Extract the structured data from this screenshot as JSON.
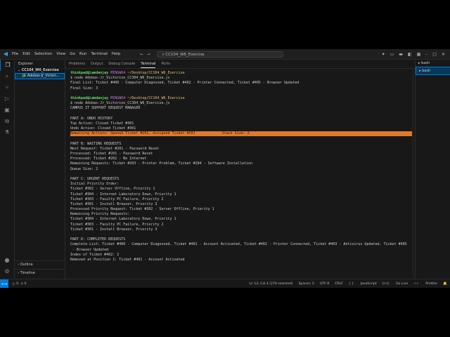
{
  "window": {
    "menu": [
      "File",
      "Edit",
      "Selection",
      "View",
      "Go",
      "Run",
      "Terminal",
      "Help"
    ],
    "search": "CC104_W6_Exercise"
  },
  "sidebar": {
    "title": "Explorer",
    "folder": "CC104_W6_Exercise",
    "file": "Adobas-Jr_Victori...",
    "outline": "Outline",
    "timeline": "Timeline"
  },
  "panel_tabs": [
    "Problems",
    "Output",
    "Debug Console",
    "Terminal",
    "Ports"
  ],
  "active_tab": "Terminal",
  "sessions": [
    "bash",
    "bash"
  ],
  "terminal": {
    "prompt_user": "thinkpad@Lamdanjay",
    "prompt_host": "MINGW64",
    "prompt_path": "~/Desktop/CC104_W6_Exercise",
    "command": "$ node Adobas-Jr_Victorino_CC304_W6_Exercise.js",
    "lines_first": [
      "Final List: Ticket #400 - Computer Diagnosed, Ticket #402 - Printer Connected, Ticket #405 - Browser Updated",
      "Final Size: 3"
    ],
    "lines_main": [
      "CAMPUS IT SUPPORT REQUEST MANAGER",
      "",
      "PART A: UNDO HISTORY",
      "Top Action: Closed Ticket #301",
      "Undo Action: Closed Ticket #301",
      "Remaining Actions: Opened Ticket #201, Assigned Ticket #201",
      "Stack Size: 2",
      "",
      "PART B: WAITING REQUESTS",
      "Next Request: Ticket #201 - Password Reset",
      "Processed: Ticket #201 - Password Reset",
      "Processed: Ticket #202 - No Internet",
      "Remaining Requests: Ticket #203 - Printer Problem, Ticket #204 - Software Installation",
      "Queue Size: 2",
      "",
      "PART C: URGENT REQUESTS",
      "Initial Priority Order:",
      "Ticket #302 - Server Offline, Priority 1",
      "Ticket #304 - Internet Laboratory Down, Priority 1",
      "Ticket #303 - Faculty PC Failure, Priority 2",
      "Ticket #301 - Install Browser, Priority 3",
      "Processed Priority Request: Ticket #302 - Server Offline, Priority 1",
      "Remaining Priority Requests:",
      "Ticket #304 - Internet Laboratory Down, Priority 1",
      "Ticket #303 - Faculty PC Failure, Priority 2",
      "Ticket #301 - Install Browser, Priority 3",
      "",
      "PART D: COMPLETED REQUESTS",
      "Complete List: Ticket #400 - Computer Diagnosed, Ticket #401 - Account Activated, Ticket #402 - Printer Connected, Ticket #403 - Antivirus Updated, Ticket #405",
      " - Browser Updated",
      "Index of Ticket #402: 2",
      "Removed at Position 1: Ticket #401 - Account Activated"
    ]
  },
  "status": {
    "errors": "0",
    "warnings": "0",
    "position": "Ln 13, Col 4 (274 selected)",
    "spaces": "Spaces: 2",
    "encoding": "UTF-8",
    "eol": "CRLF",
    "language": "JavaScript",
    "golive": "Go Live",
    "prettier": "Prettier"
  },
  "colors": {
    "accent": "#0078d4",
    "highlight": "#e07a2b"
  }
}
